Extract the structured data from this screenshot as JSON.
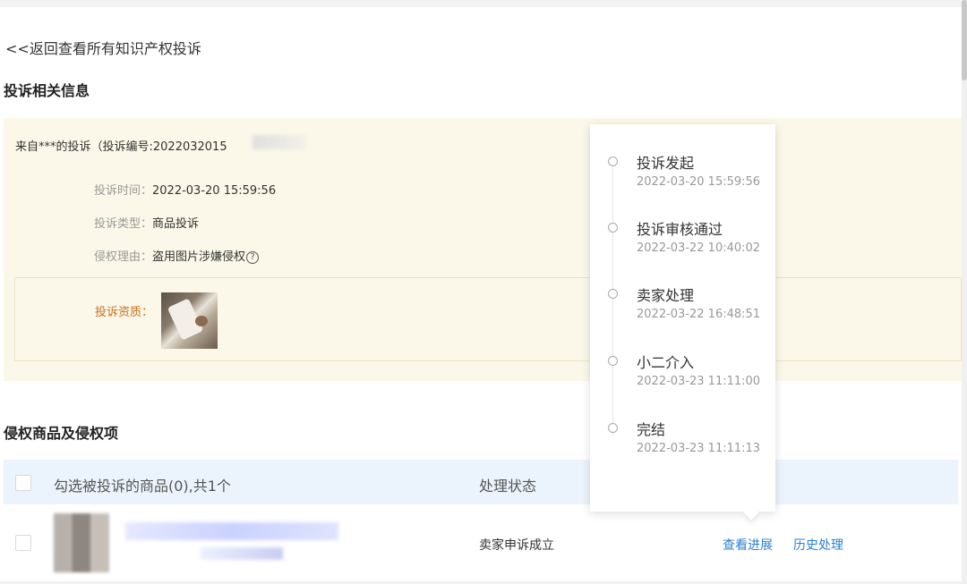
{
  "back_link": "<<返回查看所有知识产权投诉",
  "sections": {
    "complaint_info_title": "投诉相关信息",
    "infringing_items_title": "侵权商品及侵权项"
  },
  "complaint": {
    "from_line": "来自***的投诉（投诉编号:2022032015",
    "time_label": "投诉时间：",
    "time_value": "2022-03-20 15:59:56",
    "type_label": "投诉类型：",
    "type_value": "商品投诉",
    "reason_label": "侵权理由：",
    "reason_value": "盗用图片涉嫌侵权",
    "help_icon": "?",
    "qualification_label": "投诉资质："
  },
  "table": {
    "select_header": "勾选被投诉的商品(0),共1个",
    "status_header": "处理状态",
    "rows": [
      {
        "status": "卖家申诉成立",
        "action_progress": "查看进展",
        "action_history": "历史处理"
      }
    ]
  },
  "timeline": [
    {
      "title": "投诉发起",
      "time": "2022-03-20 15:59:56"
    },
    {
      "title": "投诉审核通过",
      "time": "2022-03-22 10:40:02"
    },
    {
      "title": "卖家处理",
      "time": "2022-03-22 16:48:51"
    },
    {
      "title": "小二介入",
      "time": "2022-03-23 11:11:00"
    },
    {
      "title": "完结",
      "time": "2022-03-23 11:11:13"
    }
  ],
  "colors": {
    "accent_link": "#2a7fd4",
    "panel_bg": "#fbf8e9",
    "header_bg": "#ebf4fd",
    "qualification_label": "#c8701e"
  }
}
